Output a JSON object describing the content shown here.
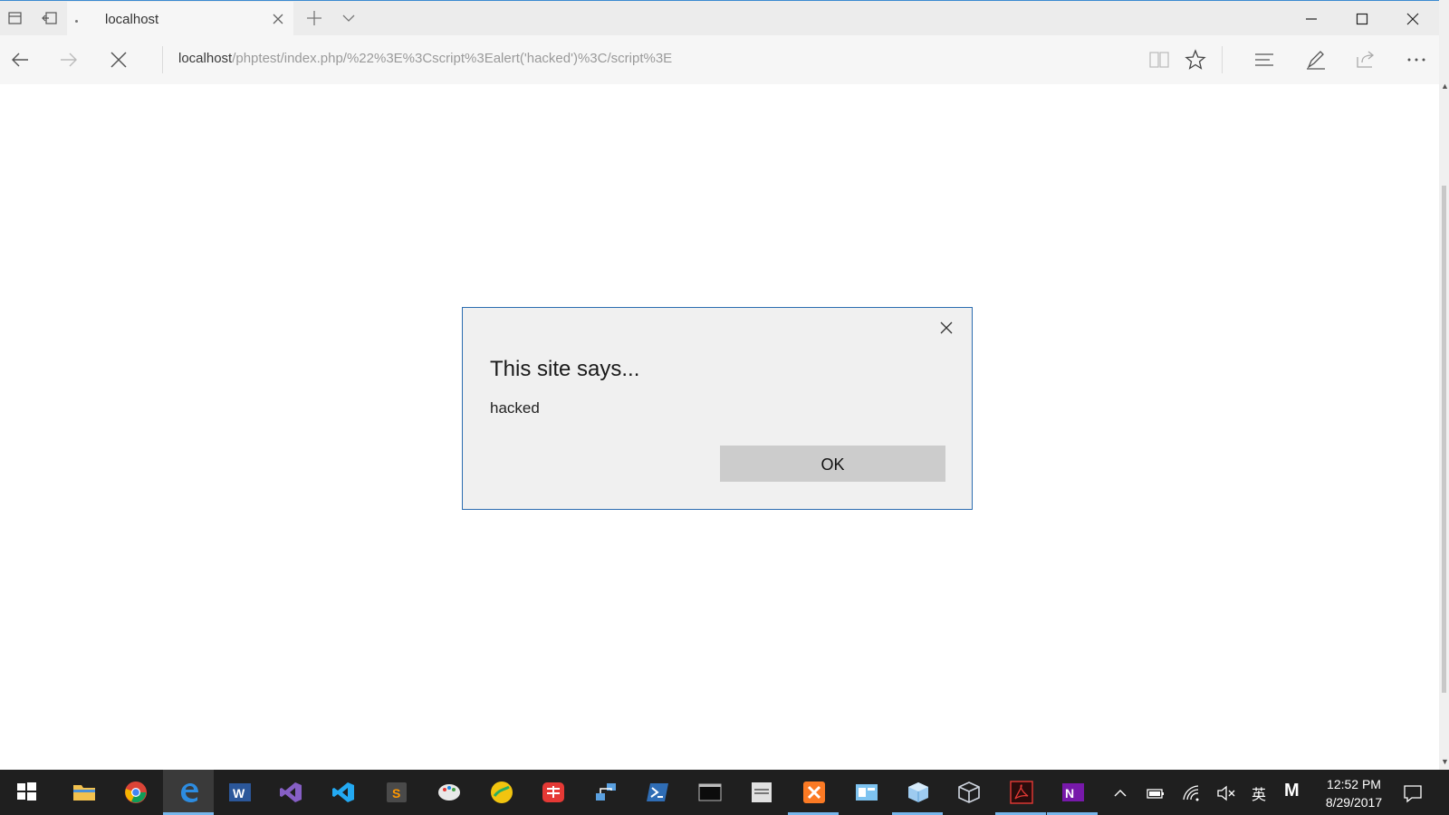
{
  "browser": {
    "tab": {
      "title": "localhost"
    },
    "address_bar": {
      "host": "localhost",
      "path": "/phptest/index.php/%22%3E%3Cscript%3Ealert('hacked')%3C/script%3E"
    },
    "toolbar_icons": [
      "reading-view-icon",
      "favorites-star-icon",
      "hub-icon",
      "web-note-icon",
      "share-icon",
      "more-icon"
    ],
    "nav_icons": [
      "back-arrow-icon",
      "forward-arrow-icon",
      "stop-icon"
    ]
  },
  "dialog": {
    "title": "This site says...",
    "message": "hacked",
    "ok_label": "OK"
  },
  "taskbar": {
    "apps": [
      "start",
      "file-explorer",
      "chrome",
      "edge",
      "word",
      "visual-studio",
      "vs-code",
      "sublime-text",
      "paint",
      "app",
      "youdao",
      "network-app",
      "powershell",
      "terminal",
      "digital-paper",
      "xampp",
      "control-panel",
      "cube-app",
      "virtualbox",
      "acrobat",
      "onenote"
    ],
    "active_app": "edge",
    "ime_mode": "M",
    "language": "英",
    "clock": {
      "time": "12:52 PM",
      "date": "8/29/2017"
    }
  },
  "colors": {
    "accent": "#2b6cb0",
    "taskbar": "#1f1f1f",
    "dialog_bg": "#f0f0f0"
  }
}
